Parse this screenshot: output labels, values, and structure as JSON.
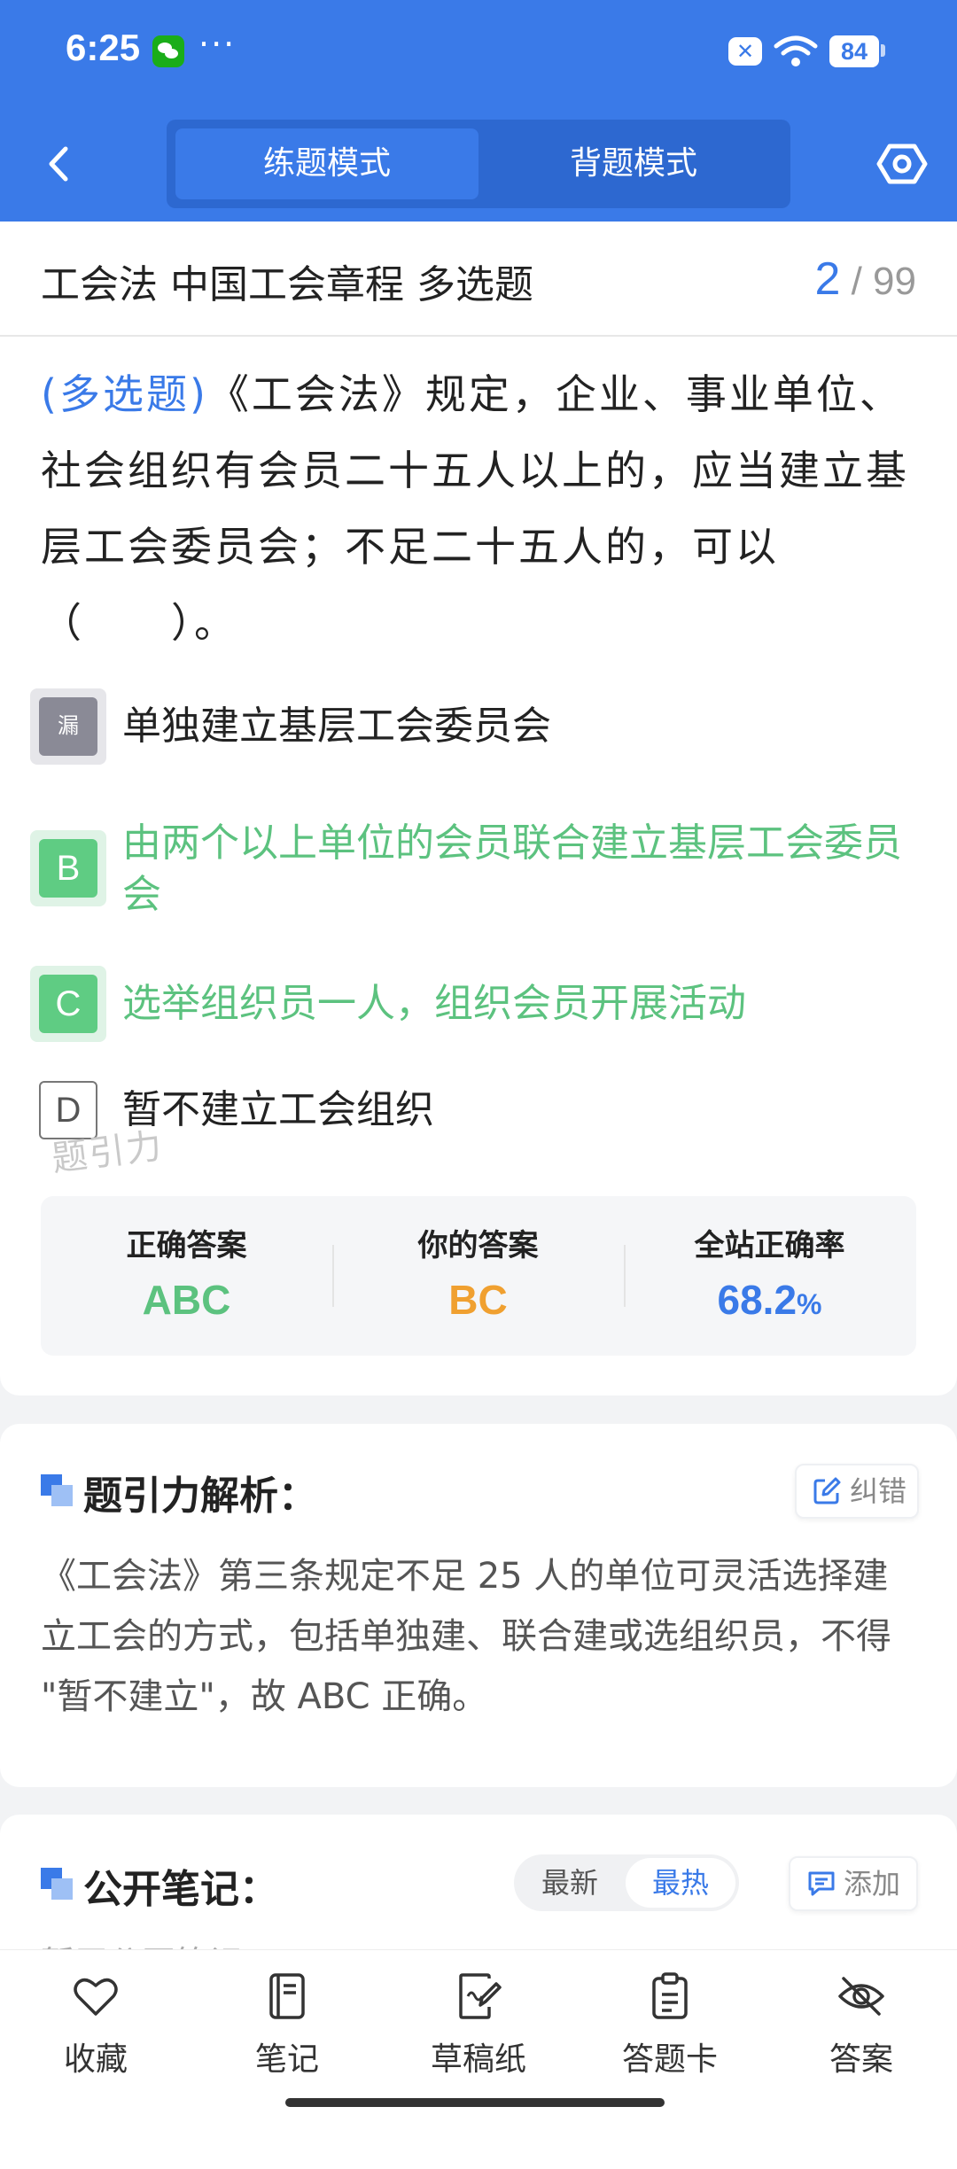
{
  "status_bar": {
    "time": "6:25",
    "more": "···",
    "battery": "84"
  },
  "header": {
    "tabs": [
      "练题模式",
      "背题模式"
    ],
    "active_tab": 0
  },
  "subheader": {
    "title": "工会法 中国工会章程 多选题",
    "current": "2",
    "total": "/ 99"
  },
  "question": {
    "type_label": "(多选题)",
    "text": "《工会法》规定，企业、事业单位、社会组织有会员二十五人以上的，应当建立基层工会委员会；不足二十五人的，可以（　　）。"
  },
  "options": [
    {
      "badge": "漏",
      "text": "单独建立基层工会委员会",
      "state": "missed"
    },
    {
      "badge": "B",
      "text": "由两个以上单位的会员联合建立基层工会委员会",
      "state": "correct"
    },
    {
      "badge": "C",
      "text": "选举组织员一人，组织会员开展活动",
      "state": "correct"
    },
    {
      "badge": "D",
      "text": "暂不建立工会组织",
      "state": "normal"
    }
  ],
  "watermark": "题引力",
  "stats": {
    "correct_label": "正确答案",
    "correct_value": "ABC",
    "yours_label": "你的答案",
    "yours_value": "BC",
    "rate_label": "全站正确率",
    "rate_value": "68.2",
    "rate_unit": "%"
  },
  "analysis": {
    "title": "题引力解析：",
    "report_label": "纠错",
    "text": "《工会法》第三条规定不足 25 人的单位可灵活选择建立工会的方式，包括单独建、联合建或选组织员，不得 \"暂不建立\"，故 ABC 正确。"
  },
  "notes": {
    "title": "公开笔记：",
    "sort_options": [
      "最新",
      "最热"
    ],
    "active_sort": 1,
    "add_label": "添加",
    "empty_text": "暂无公开笔记"
  },
  "bottom_nav": [
    "收藏",
    "笔记",
    "草稿纸",
    "答题卡",
    "答案"
  ],
  "colors": {
    "brand": "#3a7ae8",
    "correct": "#5cc27f",
    "yours": "#f0a030",
    "missed": "#8a8a96"
  }
}
